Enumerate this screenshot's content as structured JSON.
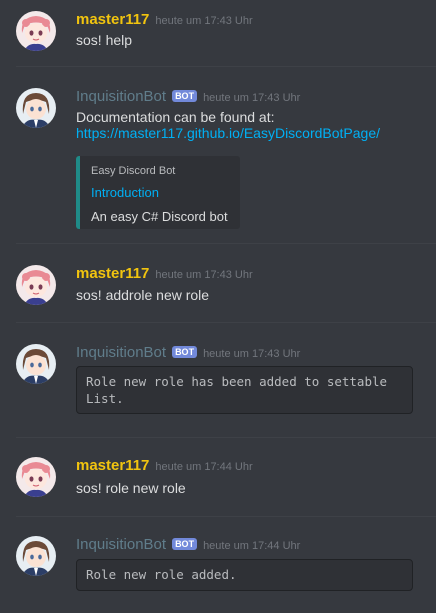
{
  "messages": [
    {
      "author": "master117",
      "timestamp": "heute um 17:43 Uhr",
      "text": "sos! help"
    },
    {
      "author": "InquisitionBot",
      "bot_tag": "BOT",
      "timestamp": "heute um 17:43 Uhr",
      "text": "Documentation can be found at:",
      "link": "https://master117.github.io/EasyDiscordBotPage/",
      "embed": {
        "provider": "Easy Discord Bot",
        "title": "Introduction",
        "description": "An easy C# Discord bot",
        "color": "#1f8b88"
      }
    },
    {
      "author": "master117",
      "timestamp": "heute um 17:43 Uhr",
      "text": "sos! addrole new role"
    },
    {
      "author": "InquisitionBot",
      "bot_tag": "BOT",
      "timestamp": "heute um 17:43 Uhr",
      "code": "Role new role has been added to settable List."
    },
    {
      "author": "master117",
      "timestamp": "heute um 17:44 Uhr",
      "text": "sos! role new role"
    },
    {
      "author": "InquisitionBot",
      "bot_tag": "BOT",
      "timestamp": "heute um 17:44 Uhr",
      "code": "Role new role added."
    }
  ],
  "colors": {
    "background": "#36393f",
    "master_name": "#f1c40f",
    "bot_name": "#607d8b",
    "bot_tag": "#7289da",
    "link": "#00b0f4"
  }
}
